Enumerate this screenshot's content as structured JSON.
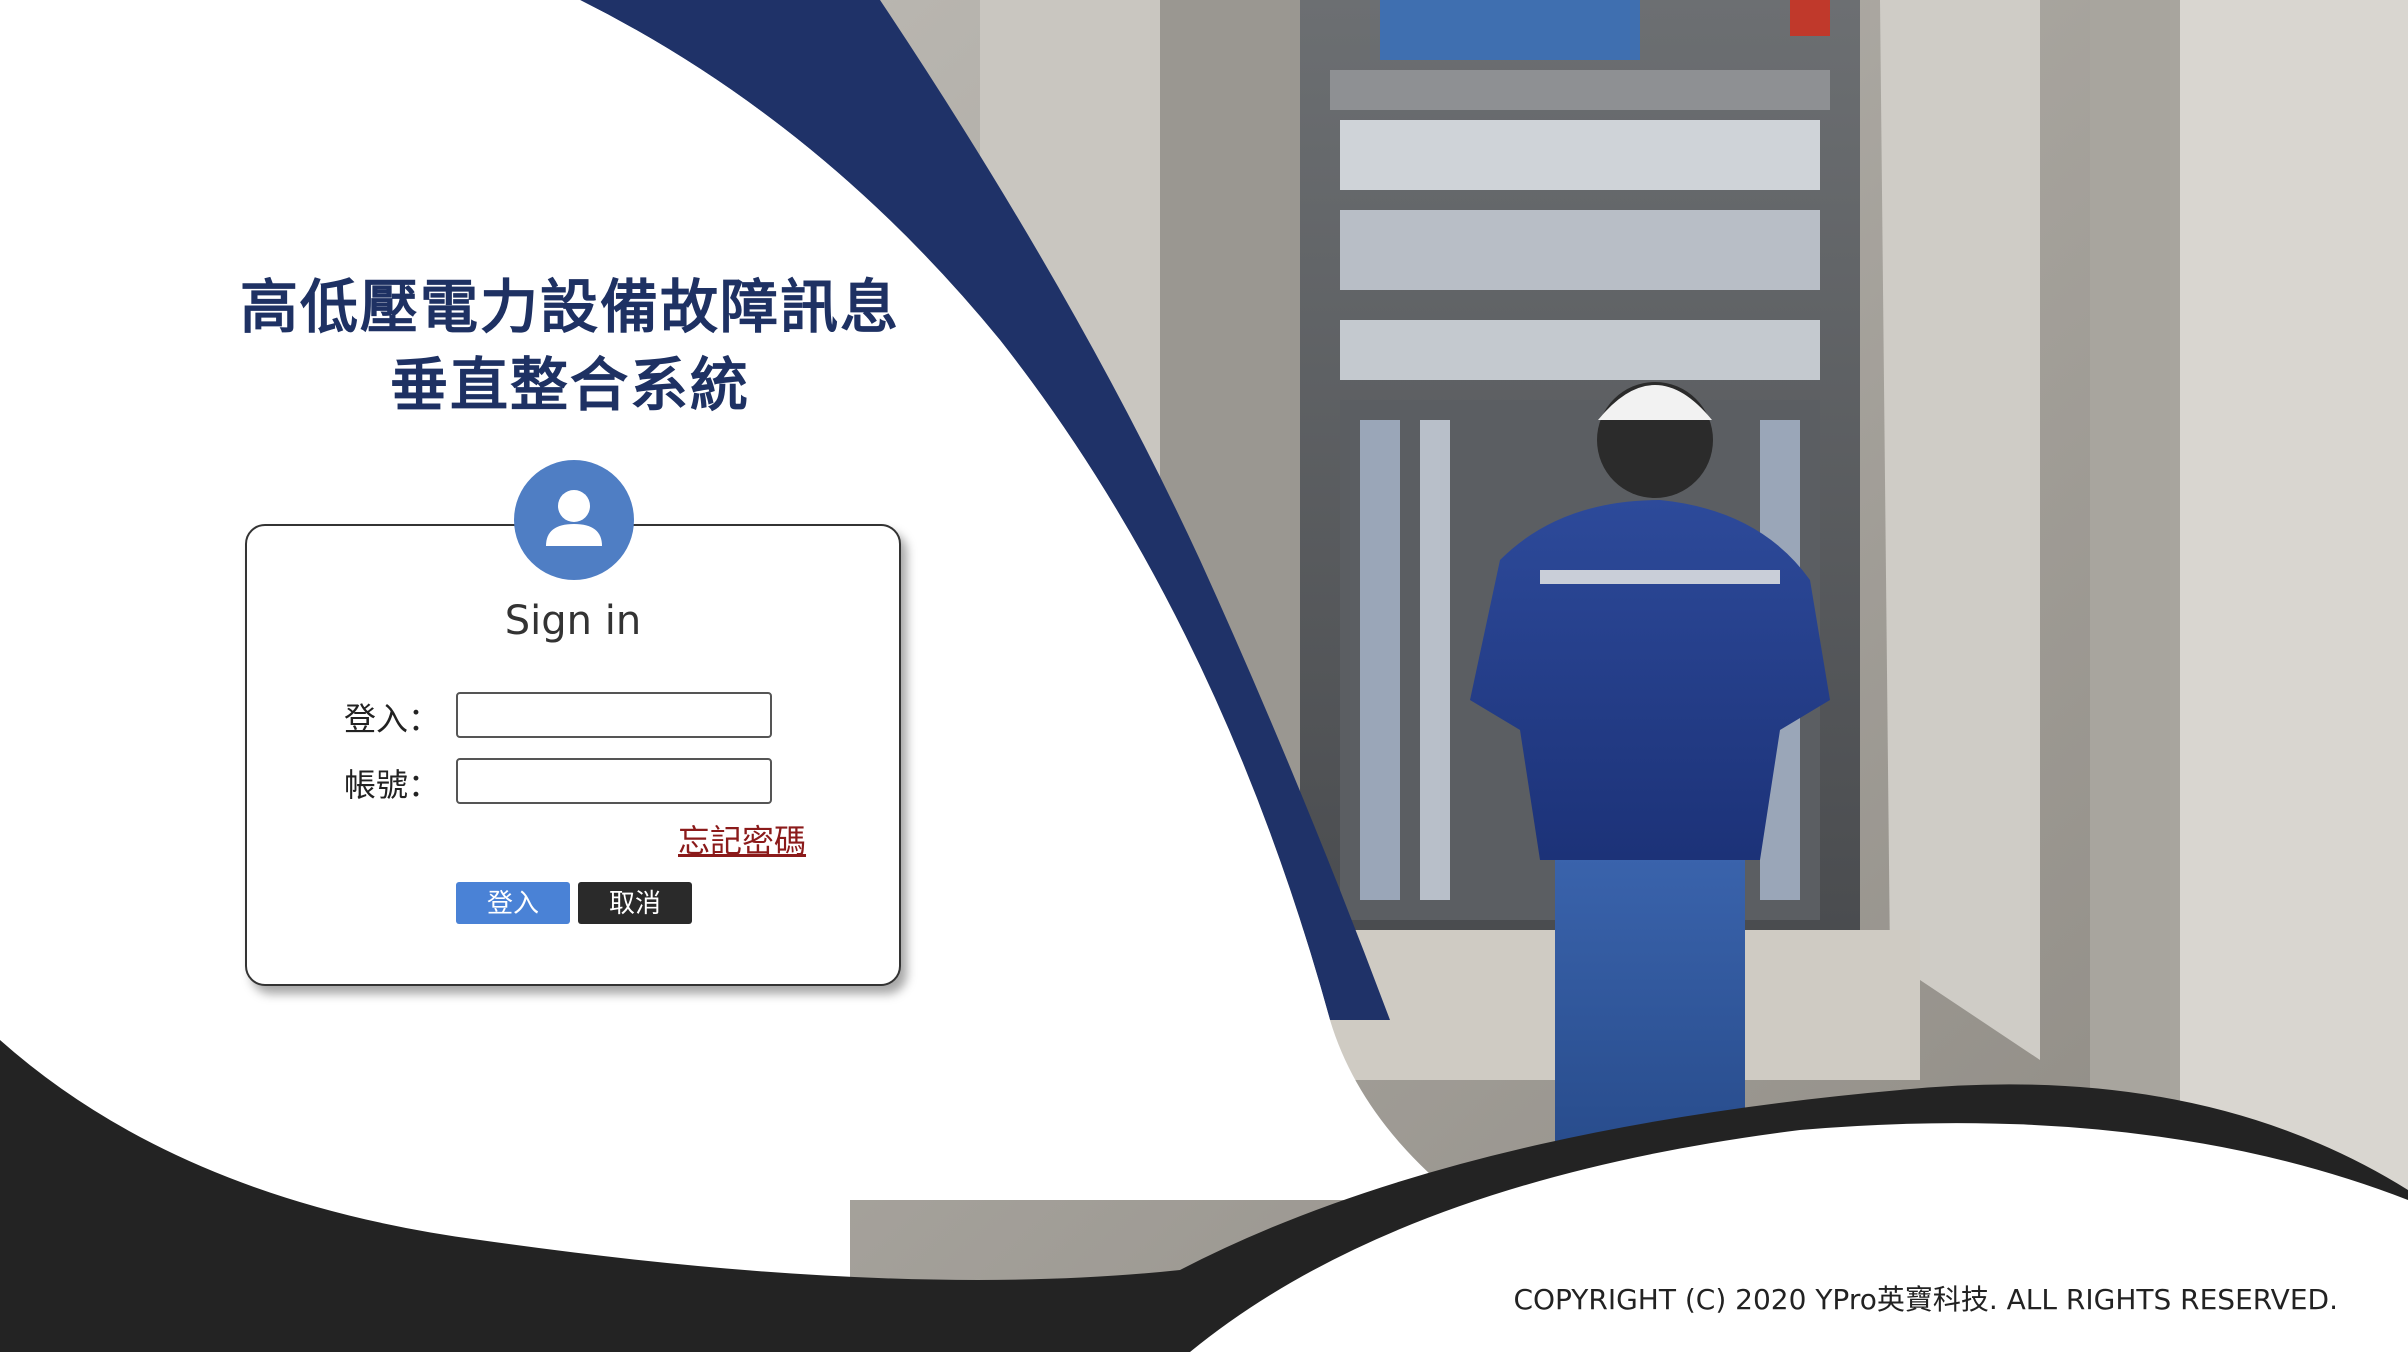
{
  "title": {
    "line1": "高低壓電力設備故障訊息",
    "line2": "垂直整合系統"
  },
  "login_card": {
    "heading": "Sign in",
    "login_label": "登入：",
    "account_label": "帳號：",
    "login_value": "",
    "account_value": "",
    "forgot_password": "忘記密碼",
    "login_button": "登入",
    "cancel_button": "取消"
  },
  "footer": {
    "copyright": "COPYRIGHT (C) 2020 YPro英寶科技. ALL RIGHTS RESERVED."
  },
  "icons": {
    "avatar": "user-icon"
  },
  "colors": {
    "title": "#1e3163",
    "navy_swoosh": "#1f3268",
    "dark_wave": "#232323",
    "avatar_bg": "#4f7ec4",
    "login_button": "#4a82d6",
    "cancel_button": "#2a2a2a",
    "forgot_link": "#8b1a1a"
  }
}
